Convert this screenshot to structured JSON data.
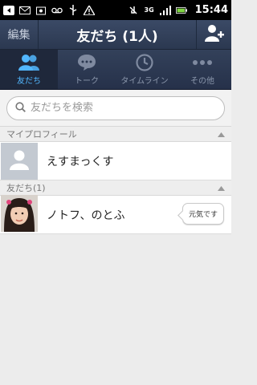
{
  "statusbar": {
    "time": "15:44",
    "network": "3G"
  },
  "header": {
    "edit_label": "編集",
    "title": "友だち (1人)"
  },
  "tabs": [
    {
      "label": "友だち",
      "icon": "friends-icon",
      "active": true
    },
    {
      "label": "トーク",
      "icon": "chat-bubble-icon",
      "active": false
    },
    {
      "label": "タイムライン",
      "icon": "clock-icon",
      "active": false
    },
    {
      "label": "その他",
      "icon": "more-dots-icon",
      "active": false
    }
  ],
  "search": {
    "placeholder": "友だちを検索",
    "value": ""
  },
  "my_profile": {
    "section_label": "マイプロフィール",
    "name": "えすまっくす"
  },
  "friends": {
    "section_label": "友だち(1)",
    "items": [
      {
        "name": "ノトフ、のとふ",
        "status": "元気です"
      }
    ]
  },
  "colors": {
    "accent": "#52b7ff",
    "header_bg": "#2b3850"
  }
}
